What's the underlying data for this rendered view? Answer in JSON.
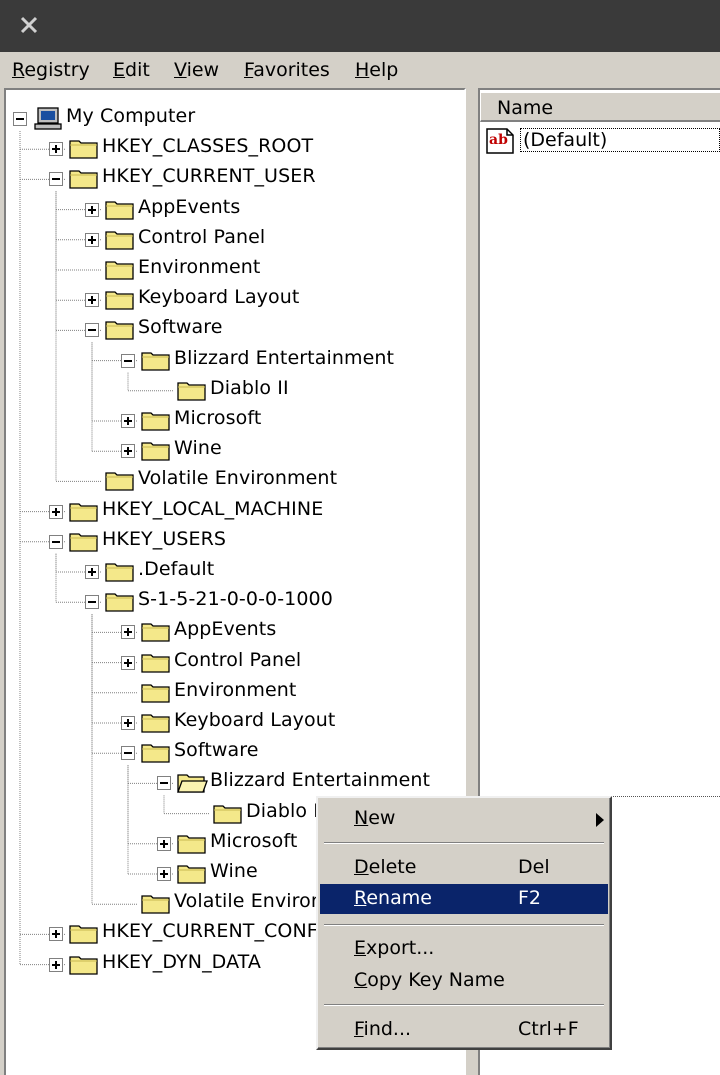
{
  "window": {
    "close_glyph": "✕"
  },
  "menubar": {
    "items": [
      {
        "first": "R",
        "rest": "egistry"
      },
      {
        "first": "E",
        "rest": "dit"
      },
      {
        "first": "V",
        "rest": "iew"
      },
      {
        "first": "F",
        "rest": "avorites"
      },
      {
        "first": "H",
        "rest": "elp"
      }
    ]
  },
  "tree": {
    "root": "My Computer",
    "hkcr": "HKEY_CLASSES_ROOT",
    "hkcu": "HKEY_CURRENT_USER",
    "hkcu_appevents": "AppEvents",
    "hkcu_control_panel": "Control Panel",
    "hkcu_environment": "Environment",
    "hkcu_keyboard_layout": "Keyboard Layout",
    "hkcu_software": "Software",
    "hkcu_blizzard": "Blizzard Entertainment",
    "hkcu_diablo": "Diablo II",
    "hkcu_microsoft": "Microsoft",
    "hkcu_wine": "Wine",
    "hkcu_volatile": "Volatile Environment",
    "hklm": "HKEY_LOCAL_MACHINE",
    "hku": "HKEY_USERS",
    "hku_default": ".Default",
    "hku_sid": "S-1-5-21-0-0-0-1000",
    "sid_appevents": "AppEvents",
    "sid_control_panel": "Control Panel",
    "sid_environment": "Environment",
    "sid_keyboard_layout": "Keyboard Layout",
    "sid_software": "Software",
    "sid_blizzard": "Blizzard Entertainment",
    "sid_diablo": "Diablo II",
    "sid_microsoft": "Microsoft",
    "sid_wine": "Wine",
    "sid_volatile": "Volatile Environment",
    "hkcc": "HKEY_CURRENT_CONFIG",
    "hkdd": "HKEY_DYN_DATA"
  },
  "list": {
    "column_name": "Name",
    "values": [
      {
        "icon": "string-value-icon",
        "icon_text": "ab",
        "name": "(Default)"
      }
    ]
  },
  "context_menu": {
    "new": {
      "first": "N",
      "rest": "ew"
    },
    "delete": {
      "first": "D",
      "rest": "elete",
      "accel": "Del"
    },
    "rename": {
      "first": "R",
      "rest": "ename",
      "accel": "F2"
    },
    "export": {
      "first": "E",
      "rest": "xport..."
    },
    "copy_key_name": {
      "first": "C",
      "rest": "opy Key Name"
    },
    "find": {
      "first": "F",
      "rest": "ind...",
      "accel": "Ctrl+F"
    }
  },
  "colors": {
    "titlebar": "#3a3a3a",
    "face": "#d4d0c8",
    "selection": "#0a246a",
    "folder_fill": "#f4e88a",
    "folder_stroke": "#000000",
    "string_icon_red": "#c00000"
  }
}
